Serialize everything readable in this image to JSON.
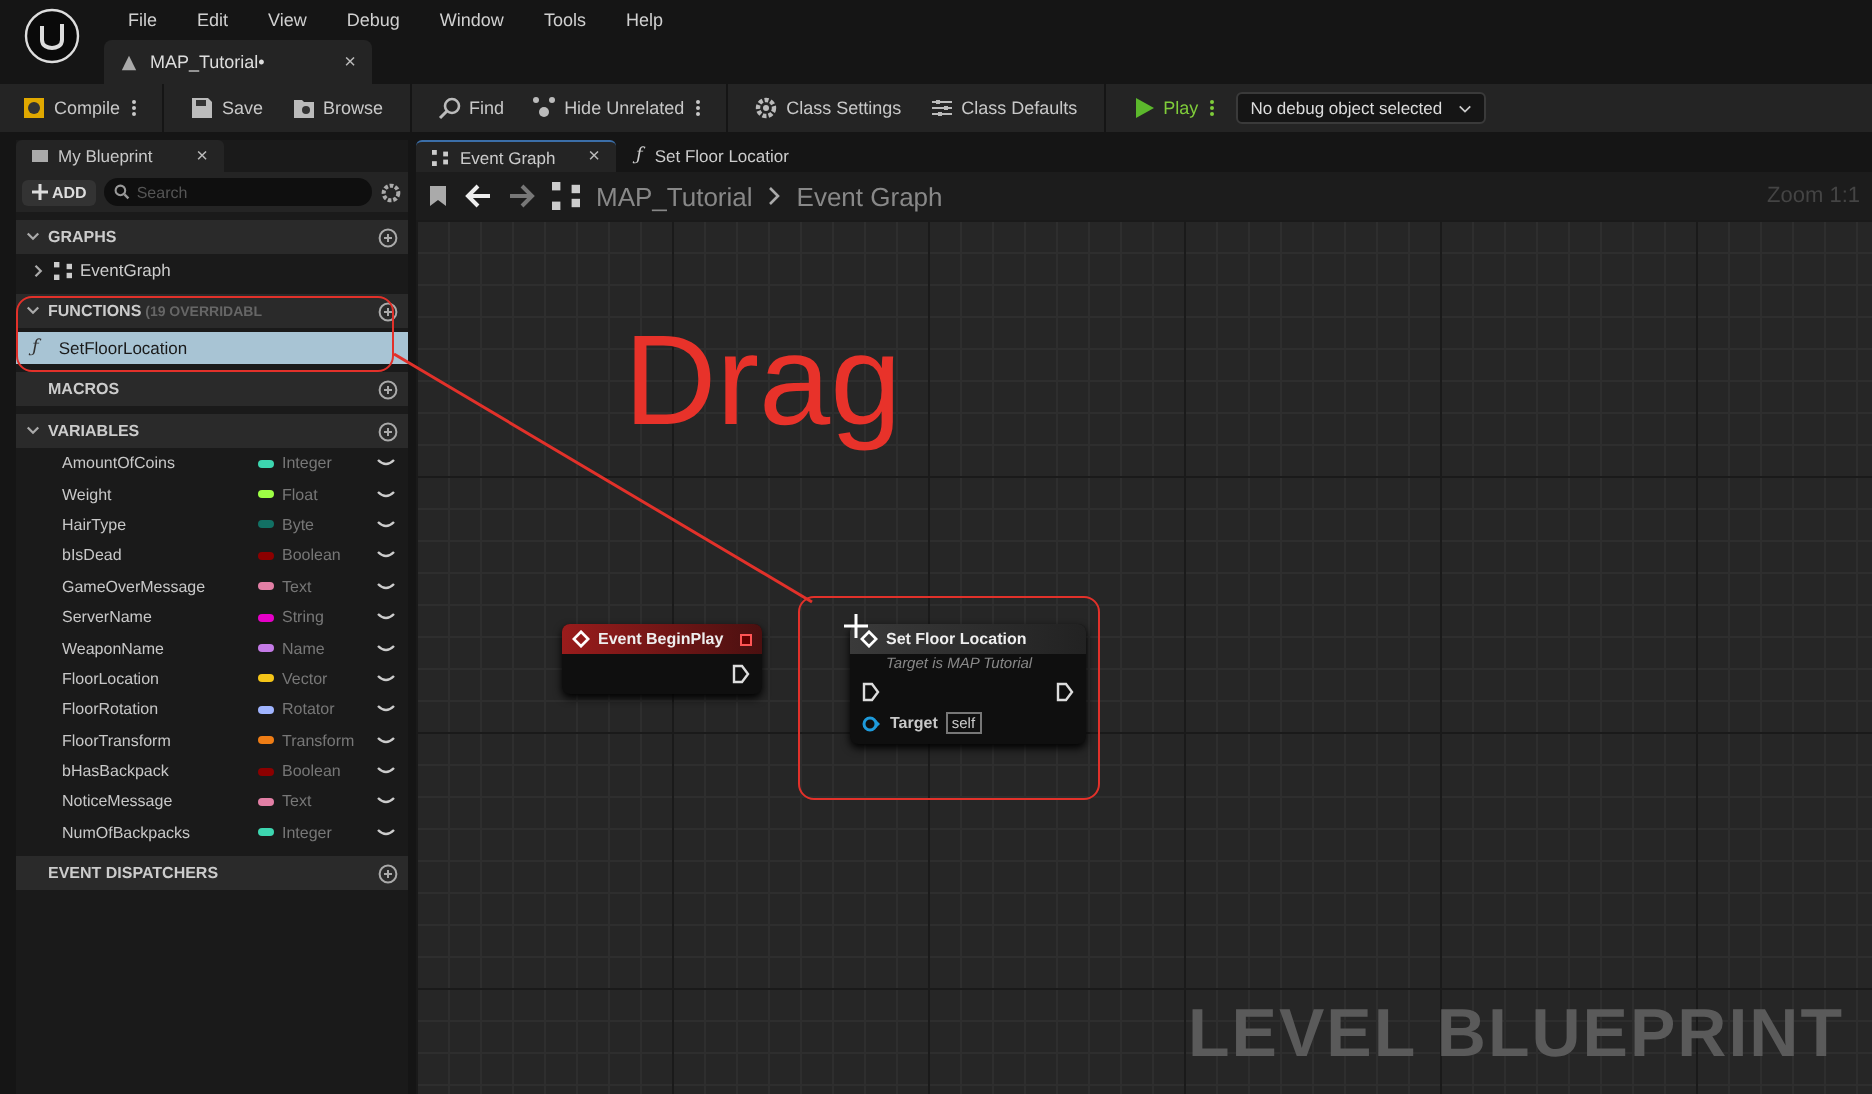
{
  "menu": [
    "File",
    "Edit",
    "View",
    "Debug",
    "Window",
    "Tools",
    "Help"
  ],
  "document_tab": {
    "title": "MAP_Tutorial•",
    "close": "×"
  },
  "toolbar": [
    {
      "kind": "compile",
      "label": "Compile",
      "more": true
    },
    {
      "kind": "save",
      "label": "Save",
      "more": false
    },
    {
      "kind": "browse",
      "label": "Browse",
      "more": false
    },
    {
      "kind": "find",
      "label": "Find",
      "more": false
    },
    {
      "kind": "hide",
      "label": "Hide Unrelated",
      "more": true
    },
    {
      "kind": "settings",
      "label": "Class Settings",
      "more": false
    },
    {
      "kind": "defaults",
      "label": "Class Defaults",
      "more": false
    },
    {
      "kind": "play",
      "label": "Play",
      "more": true
    }
  ],
  "debug_dropdown": {
    "value": "No debug object selected"
  },
  "my_blueprint": {
    "tab": "My Blueprint",
    "close": "×",
    "add_button": "ADD",
    "search": {
      "placeholder": "Search"
    },
    "sections": [
      {
        "title": "GRAPHS",
        "expanded": true,
        "items": [
          {
            "label": "EventGraph",
            "kind": "graph",
            "expanded": false,
            "selected": false
          }
        ]
      },
      {
        "title": "FUNCTIONS",
        "note": "(19 OVERRIDABL",
        "expanded": true,
        "items": [
          {
            "label": "SetFloorLocation",
            "kind": "function",
            "icon": "ƒ",
            "selected": true
          }
        ]
      },
      {
        "title": "MACROS"
      },
      {
        "title": "VARIABLES",
        "expanded": true,
        "variables": [
          {
            "name": "AmountOfCoins",
            "type": "Integer",
            "color": "#3dd6b0"
          },
          {
            "name": "Weight",
            "type": "Float",
            "color": "#9eff45"
          },
          {
            "name": "HairType",
            "type": "Byte",
            "color": "#127064"
          },
          {
            "name": "bIsDead",
            "type": "Boolean",
            "color": "#8c0000"
          },
          {
            "name": "GameOverMessage",
            "type": "Text",
            "color": "#e27fa5"
          },
          {
            "name": "ServerName",
            "type": "String",
            "color": "#e600c8"
          },
          {
            "name": "WeaponName",
            "type": "Name",
            "color": "#c47ae6"
          },
          {
            "name": "FloorLocation",
            "type": "Vector",
            "color": "#f5c518"
          },
          {
            "name": "FloorRotation",
            "type": "Rotator",
            "color": "#a0b4ff"
          },
          {
            "name": "FloorTransform",
            "type": "Transform",
            "color": "#ef7d15"
          },
          {
            "name": "bHasBackpack",
            "type": "Boolean",
            "color": "#8c0000"
          },
          {
            "name": "NoticeMessage",
            "type": "Text",
            "color": "#e27fa5"
          },
          {
            "name": "NumOfBackpacks",
            "type": "Integer",
            "color": "#3dd6b0"
          }
        ]
      },
      {
        "title": "EVENT DISPATCHERS"
      }
    ]
  },
  "graph_tabs": [
    {
      "label": "Event Graph",
      "kind": "graph",
      "selected": true,
      "close": "×"
    },
    {
      "label": "Set Floor Locatior",
      "kind": "function",
      "icon": "ƒ",
      "selected": false
    }
  ],
  "breadcrumb": [
    "MAP_Tutorial",
    "Event Graph"
  ],
  "zoom": "Zoom 1:1",
  "nodes": [
    {
      "kind": "event",
      "title": "Event BeginPlay"
    },
    {
      "kind": "function",
      "title": "Set Floor Location",
      "subtitle": "Target is MAP Tutorial",
      "pin": "Target",
      "pin_value": "self"
    }
  ],
  "annotation": {
    "text": "Drag"
  },
  "watermark_label": "LEVEL BLUEPRINT"
}
